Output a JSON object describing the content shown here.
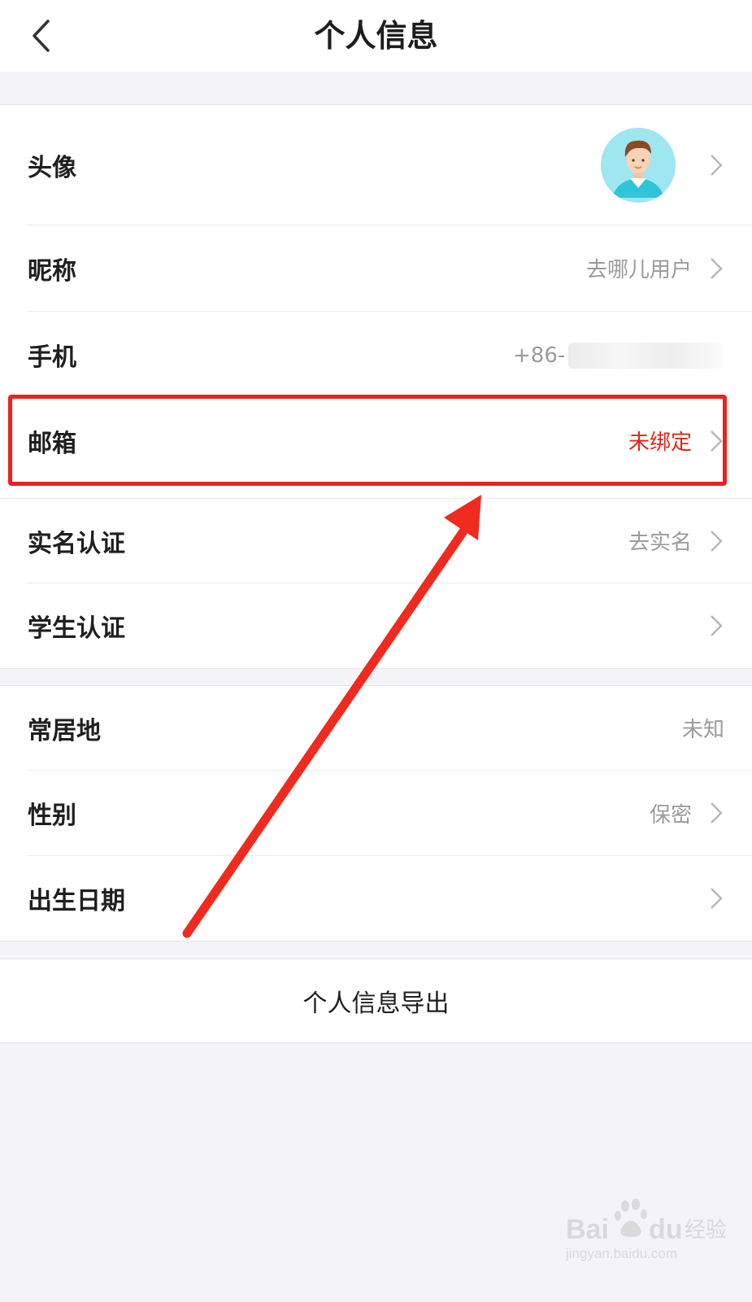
{
  "header": {
    "title": "个人信息",
    "back_icon": "chevron-left-icon"
  },
  "group1": [
    {
      "label": "头像",
      "value": "",
      "has_arrow": true,
      "avatar": true
    },
    {
      "label": "昵称",
      "value": "去哪儿用户",
      "has_arrow": true
    },
    {
      "label": "手机",
      "value": "+86-",
      "has_arrow": false,
      "blurred": true
    },
    {
      "label": "邮箱",
      "value": "未绑定",
      "has_arrow": true,
      "value_color": "#e1251b"
    },
    {
      "label": "实名认证",
      "value": "去实名",
      "has_arrow": true
    },
    {
      "label": "学生认证",
      "value": "",
      "has_arrow": true
    }
  ],
  "group2": [
    {
      "label": "常居地",
      "value": "未知",
      "has_arrow": false
    },
    {
      "label": "性别",
      "value": "保密",
      "has_arrow": true
    },
    {
      "label": "出生日期",
      "value": "",
      "has_arrow": true
    }
  ],
  "export_label": "个人信息导出",
  "annotation": {
    "highlight_color": "#e8231d",
    "arrow_color": "#f02a1f"
  },
  "watermark": {
    "brand": "Baidu经验",
    "url": "jingyan.baidu.com"
  }
}
